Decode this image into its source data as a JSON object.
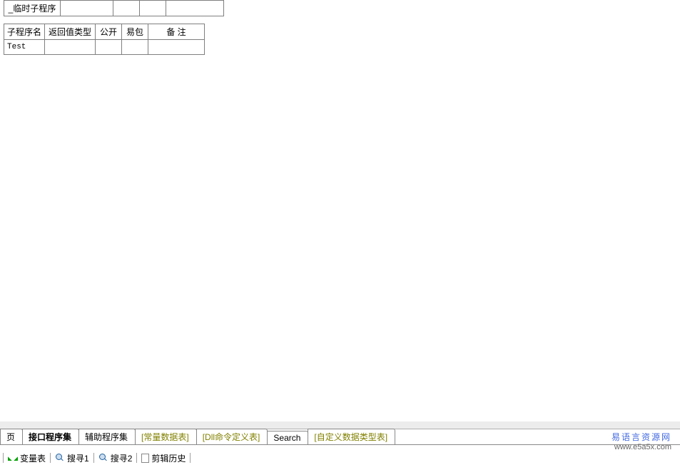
{
  "table1": {
    "row": [
      "_临时子程序",
      "",
      "",
      "",
      ""
    ]
  },
  "table2": {
    "headers": [
      "子程序名",
      "返回值类型",
      "公开",
      "易包",
      "备 注"
    ],
    "row": [
      "Test",
      "",
      "",
      "",
      ""
    ]
  },
  "editor_tabs": {
    "t0": "页",
    "t1": "接口程序集",
    "t2": "辅助程序集",
    "t3": "[常量数据表]",
    "t4": "[Dll命令定义表]",
    "t5": "Search",
    "t6": "[自定义数据类型表]"
  },
  "bottom_bar": {
    "b0": "变量表",
    "b1": "搜寻1",
    "b2": "搜寻2",
    "b3": "剪辑历史"
  },
  "watermark": {
    "l1": "易语言资源网",
    "l2": "www.e5a5x.com"
  }
}
